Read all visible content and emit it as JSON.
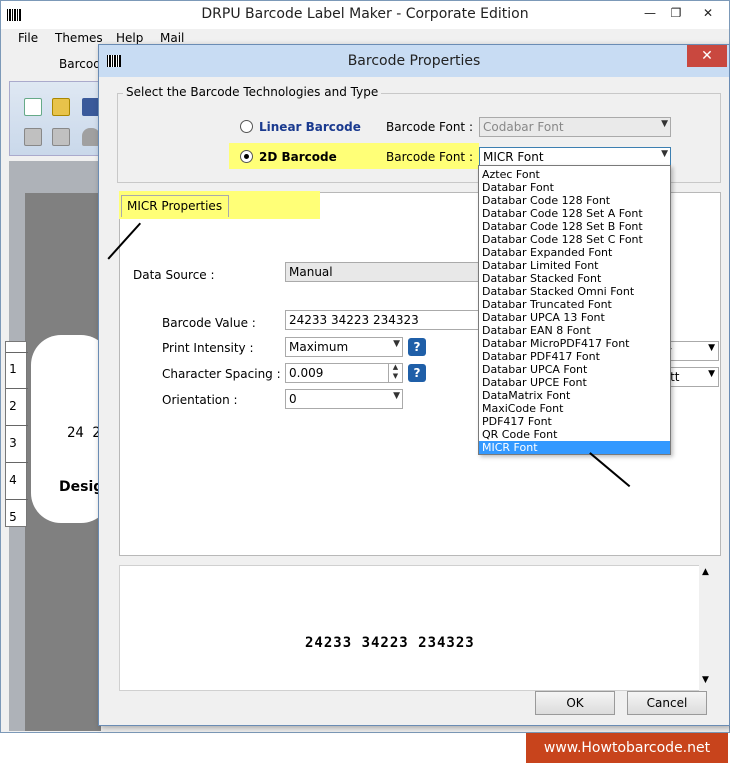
{
  "app": {
    "title": "DRPU Barcode Label Maker - Corporate Edition",
    "menu": [
      {
        "label": "File"
      },
      {
        "label": "Themes"
      },
      {
        "label": "Help"
      },
      {
        "label": "Mail"
      }
    ],
    "toolbar_label": "Barcode",
    "ruler_marks": [
      "1",
      "2",
      "3",
      "4",
      "5"
    ],
    "label_preview": {
      "barcode_text": "24 2",
      "design_text": "Desig"
    }
  },
  "dialog": {
    "title": "Barcode Properties",
    "tech_group_label": "Select the Barcode Technologies and Type",
    "linear": {
      "label": "Linear Barcode",
      "font_label": "Barcode Font :",
      "font_value": "Codabar Font",
      "selected": false
    },
    "twod": {
      "label": "2D Barcode",
      "font_label": "Barcode Font :",
      "font_value": "MICR Font",
      "selected": true
    },
    "tab_label": "MICR Properties",
    "fields": {
      "data_source": {
        "label": "Data Source :",
        "value": "Manual"
      },
      "barcode_value": {
        "label": "Barcode Value :",
        "value": "24233 34223 234323"
      },
      "print_intensity": {
        "label": "Print Intensity :",
        "value": "Maximum"
      },
      "character_spacing": {
        "label": "Character Spacing :",
        "value": "0.009"
      },
      "orientation": {
        "label": "Orientation :",
        "value": "0"
      }
    },
    "right_combos": [
      "ry",
      "s tt"
    ],
    "preview_barcode": "24233 34223 234323",
    "ok_label": "OK",
    "cancel_label": "Cancel",
    "dropdown_items": [
      "Aztec Font",
      "Databar Font",
      "Databar Code 128 Font",
      "Databar Code 128 Set A Font",
      "Databar Code 128 Set B Font",
      "Databar Code 128 Set C Font",
      "Databar Expanded Font",
      "Databar Limited Font",
      "Databar Stacked Font",
      "Databar Stacked Omni Font",
      "Databar Truncated Font",
      "Databar UPCA 13 Font",
      "Databar EAN 8 Font",
      "Databar MicroPDF417 Font",
      "Databar PDF417 Font",
      "Databar UPCA Font",
      "Databar UPCE Font",
      "DataMatrix Font",
      "MaxiCode Font",
      "PDF417 Font",
      "QR Code Font",
      "MICR Font"
    ],
    "dropdown_selected_index": 21
  },
  "watermark": "www.Howtobarcode.net",
  "colors": {
    "highlight": "#ffff77",
    "selection": "#3399ff",
    "close_button": "#c9483f",
    "watermark_bg": "#c8441c",
    "help_icon": "#1f5fa8"
  },
  "icons": [
    "barcode-app-icon",
    "minimize-icon",
    "maximize-icon",
    "close-icon",
    "help-icon",
    "chevron-down-icon",
    "spinner-icon"
  ]
}
